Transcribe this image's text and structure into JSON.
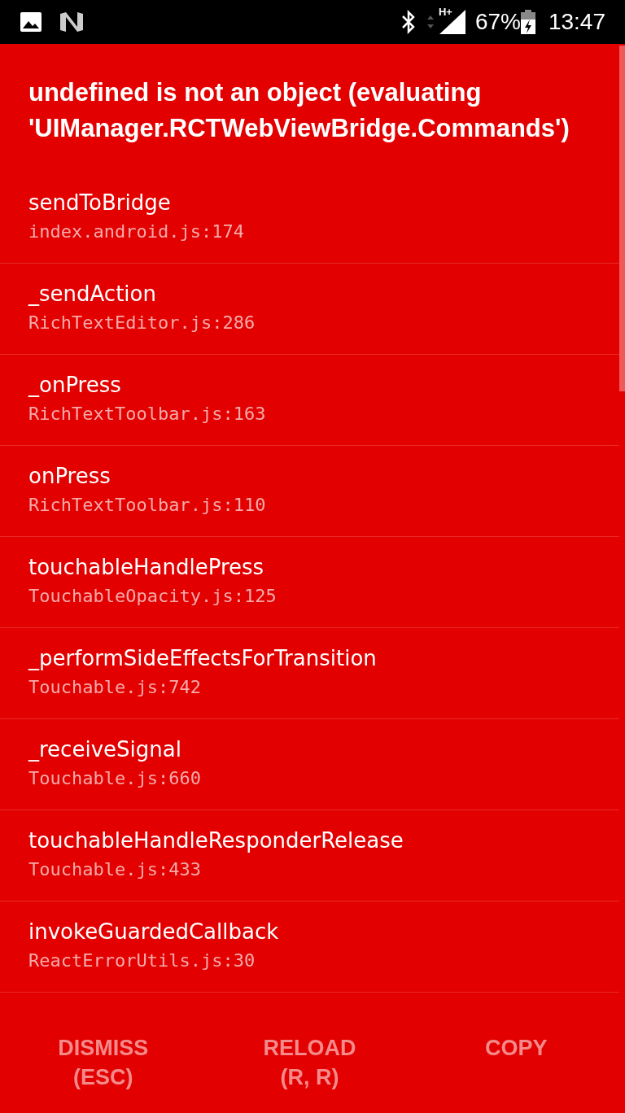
{
  "status_bar": {
    "network": "H+",
    "battery": "67%",
    "time": "13:47"
  },
  "error": {
    "title": "undefined is not an object (evaluating 'UIManager.RCTWebViewBridge.Commands')"
  },
  "stack": [
    {
      "method": "sendToBridge",
      "location": "index.android.js:174"
    },
    {
      "method": "_sendAction",
      "location": "RichTextEditor.js:286"
    },
    {
      "method": "_onPress",
      "location": "RichTextToolbar.js:163"
    },
    {
      "method": "onPress",
      "location": "RichTextToolbar.js:110"
    },
    {
      "method": "touchableHandlePress",
      "location": "TouchableOpacity.js:125"
    },
    {
      "method": "_performSideEffectsForTransition",
      "location": "Touchable.js:742"
    },
    {
      "method": "_receiveSignal",
      "location": "Touchable.js:660"
    },
    {
      "method": "touchableHandleResponderRelease",
      "location": "Touchable.js:433"
    },
    {
      "method": "invokeGuardedCallback",
      "location": "ReactErrorUtils.js:30"
    }
  ],
  "buttons": [
    {
      "label": "DISMISS",
      "hint": "(ESC)"
    },
    {
      "label": "RELOAD",
      "hint": "(R, R)"
    },
    {
      "label": "COPY"
    }
  ]
}
